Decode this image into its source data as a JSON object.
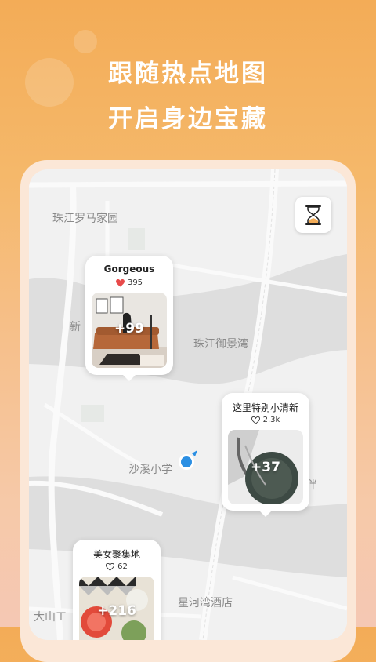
{
  "headline": {
    "line1": "跟随热点地图",
    "line2": "开启身边宝藏"
  },
  "map": {
    "labels": {
      "zhujiang_roma": "珠江罗马家园",
      "xin": "新",
      "zhujiang_yujing": "珠江御景湾",
      "shaxi_school": "沙溪小学",
      "ban": "伴",
      "xinghewan_hotel": "星河湾酒店",
      "dashan": "大山工"
    },
    "timer_icon": "hourglass-icon",
    "location_icon": "location-marker-icon"
  },
  "pins": [
    {
      "title": "Gorgeous",
      "likes": "395",
      "liked": true,
      "count": "+99"
    },
    {
      "title": "这里特别小清新",
      "likes": "2.3k",
      "liked": false,
      "count": "+37"
    },
    {
      "title": "美女聚集地",
      "likes": "62",
      "liked": false,
      "count": "+216"
    }
  ],
  "colors": {
    "accent": "#f3ac57",
    "heart_filled": "#e84a4a",
    "location": "#2b8fe3"
  }
}
